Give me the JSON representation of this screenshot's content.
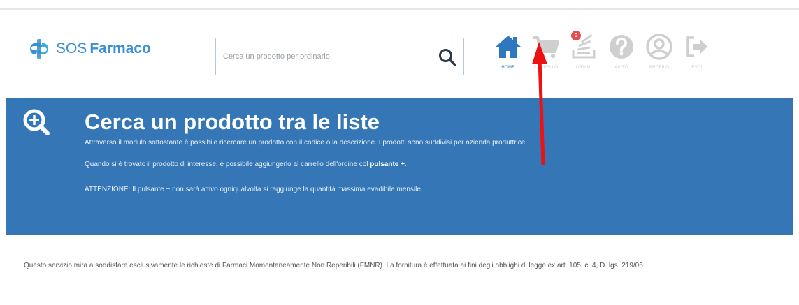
{
  "brand": {
    "sos": "SOS",
    "farmaco": "Farmaco",
    "color": "#3a8fd6"
  },
  "search": {
    "placeholder": "Cerca un prodotto per ordinario",
    "value": ""
  },
  "nav": [
    {
      "label": "HOME",
      "icon": "home-icon",
      "active": true
    },
    {
      "label": "CARRELLO",
      "icon": "cart-icon",
      "badge": "0"
    },
    {
      "label": "ORDINI",
      "icon": "orders-icon"
    },
    {
      "label": "AIUTO",
      "icon": "help-icon"
    },
    {
      "label": "PROFILO",
      "icon": "profile-icon"
    },
    {
      "label": "ESCI",
      "icon": "logout-icon"
    }
  ],
  "banner": {
    "title": "Cerca un prodotto tra le liste",
    "p1": "Attraverso il modulo sottostante è possibile ricercare un prodotto con il codice o la descrizione. I prodotti sono suddivisi per azienda produttrice.",
    "p2_pre": "Quando si è trovato il prodotto di interesse, è possibile aggiungerlo al carrello dell'ordine col ",
    "p2_bold": "pulsante +",
    "p2_post": ".",
    "p3": "ATTENZIONE: Il pulsante + non sarà attivo ogniqualvolta si raggiunge la quantità massima evadibile mensile.",
    "color": "#3576b6"
  },
  "notice": "Questo servizio mira a soddisfare esclusivamente le richieste di Farmaci Momentaneamente Non Reperibili (FMNR). La fornitura è effettuata ai fini degli obblighi di legge ex art. 105, c. 4, D. lgs. 219/06"
}
